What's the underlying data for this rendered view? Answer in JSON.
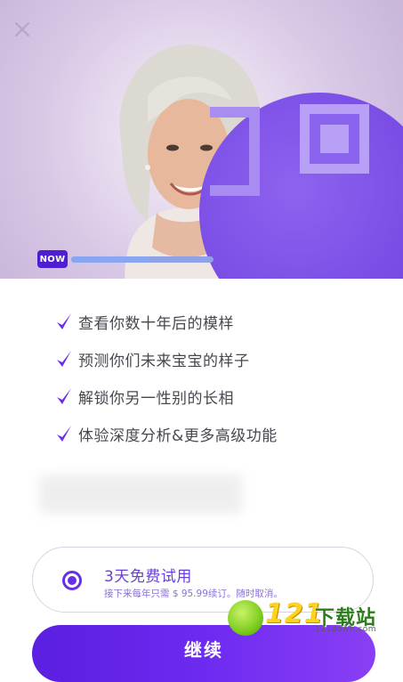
{
  "hero": {
    "badge": "NOW",
    "progress": 0.55
  },
  "features": [
    {
      "label": "查看你数十年后的模样",
      "icon": "check-icon"
    },
    {
      "label": "预测你们未来宝宝的样子",
      "icon": "check-icon"
    },
    {
      "label": "解锁你另一性别的长相",
      "icon": "check-icon"
    },
    {
      "label": "体验深度分析&更多高级功能",
      "icon": "check-icon"
    }
  ],
  "trial": {
    "title": "3天免费试用",
    "subtitle": "接下来每年只需 $ 95.99续订。随时取消。",
    "selected": true
  },
  "continue_label": "继续",
  "watermark": {
    "number": "121",
    "text": "下载站",
    "url": "121down.com"
  },
  "colors": {
    "accent": "#6a2ee6",
    "badge": "#4e1ed1",
    "hero_bg": "#cbb9dc",
    "blob": "#7b4fe6"
  }
}
